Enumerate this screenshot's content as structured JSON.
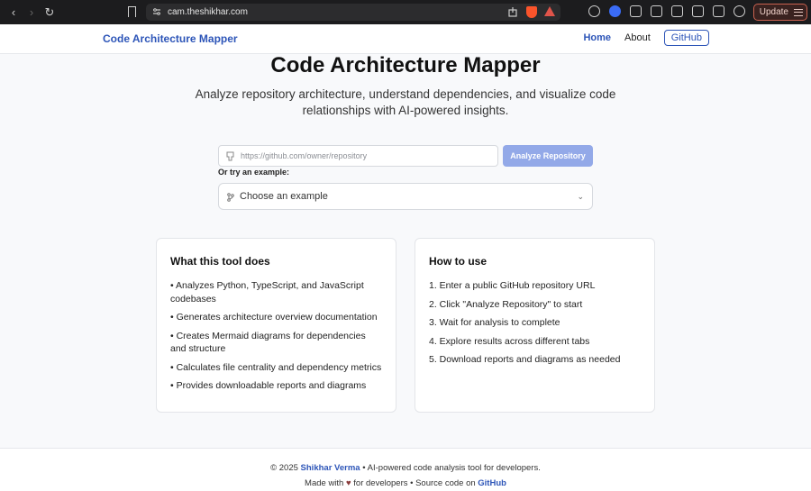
{
  "browser": {
    "url": "cam.theshikhar.com",
    "update_label": "Update"
  },
  "nav": {
    "brand": "Code Architecture Mapper",
    "home": "Home",
    "about": "About",
    "github": "GitHub"
  },
  "hero": {
    "title": "Code Architecture Mapper",
    "subtitle": "Analyze repository architecture, understand dependencies, and visualize code relationships with AI-powered insights."
  },
  "form": {
    "repo_placeholder": "https://github.com/owner/repository",
    "analyze_label": "Analyze Repository",
    "try_label": "Or try an example:",
    "example_selected": "Choose an example"
  },
  "cards": {
    "what": {
      "title": "What this tool does",
      "items": [
        "• Analyzes Python, TypeScript, and JavaScript codebases",
        "• Generates architecture overview documentation",
        "• Creates Mermaid diagrams for dependencies and structure",
        "• Calculates file centrality and dependency metrics",
        "• Provides downloadable reports and diagrams"
      ]
    },
    "how": {
      "title": "How to use",
      "items": [
        "1. Enter a public GitHub repository URL",
        "2. Click \"Analyze Repository\" to start",
        "3. Wait for analysis to complete",
        "4. Explore results across different tabs",
        "5. Download reports and diagrams as needed"
      ]
    }
  },
  "footer": {
    "copyright": "© 2025",
    "author": "Shikhar Verma",
    "tagline": "• AI-powered code analysis tool for developers.",
    "made_with": "Made with",
    "heart": "♥",
    "for_devs": "for developers • Source code on",
    "github_link": "GitHub"
  },
  "colors": {
    "brand": "#2d55b8",
    "button_disabled": "#93a9e8"
  }
}
